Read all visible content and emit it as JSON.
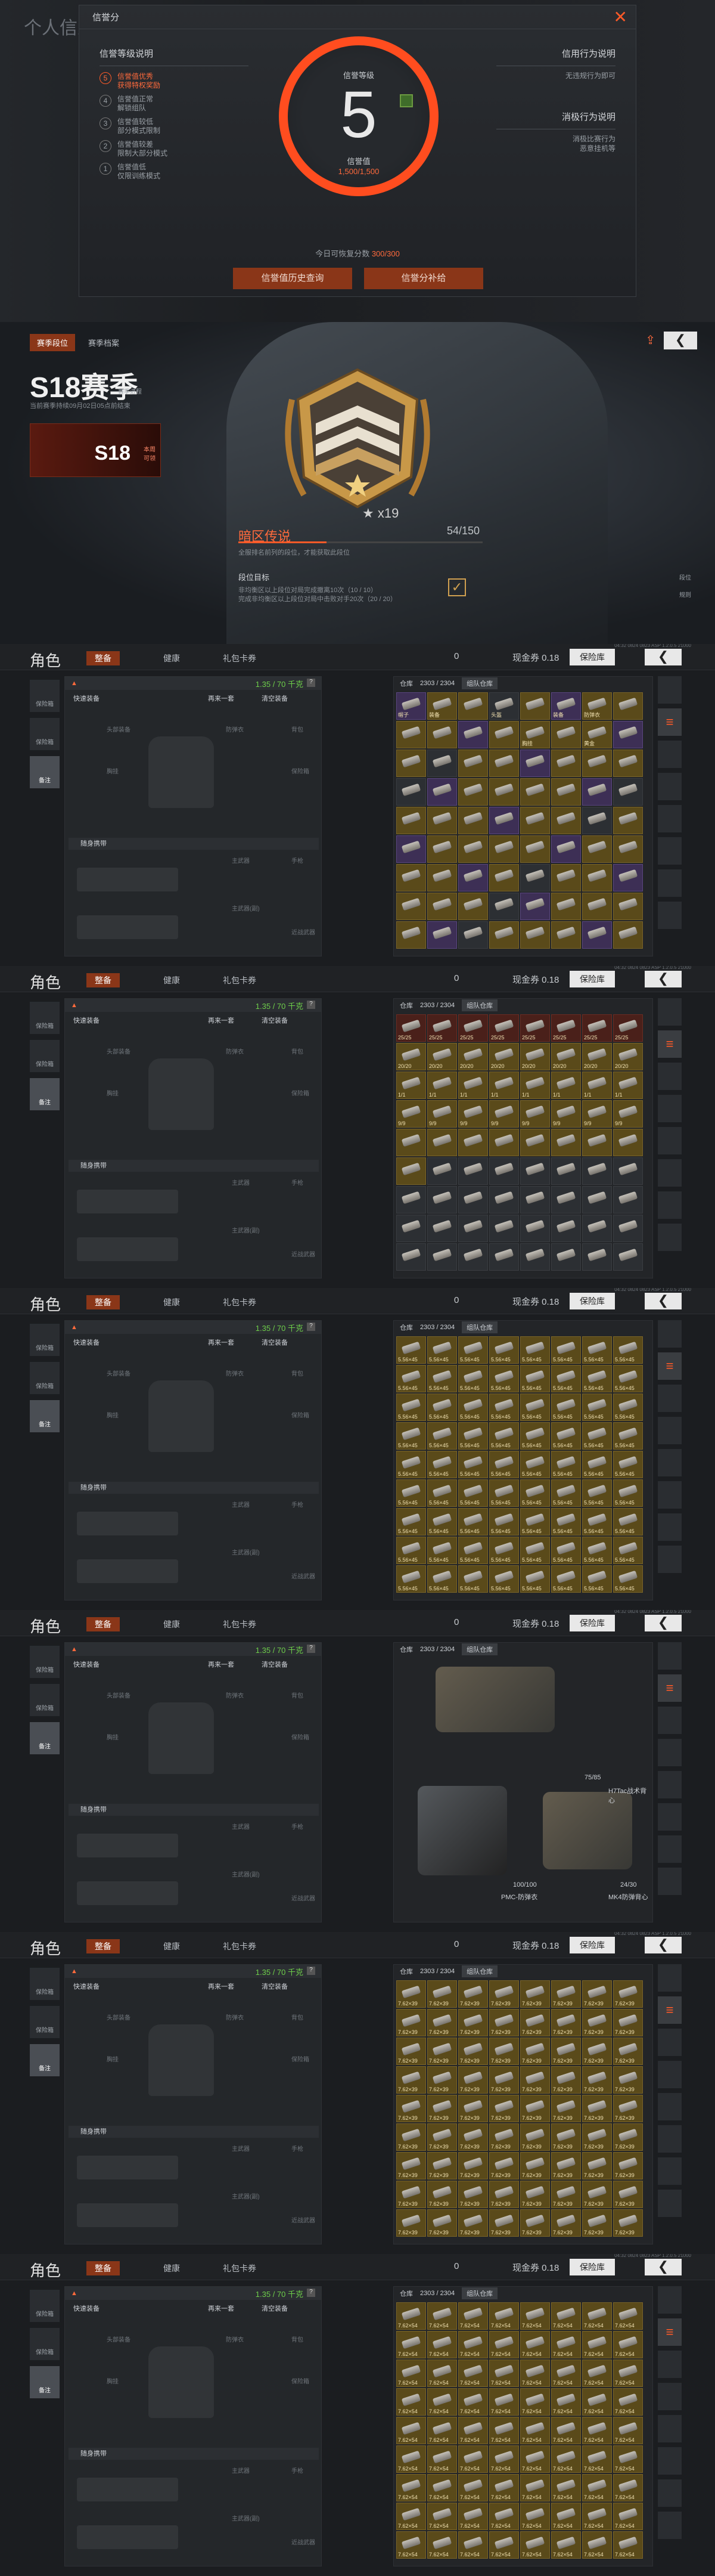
{
  "credit": {
    "bg_title": "个人信息",
    "title": "信誉分",
    "close": "✕",
    "left_heading": "信誉等级说明",
    "levels": [
      {
        "n": "5",
        "text": "信誉值优秀\n获得特权奖励"
      },
      {
        "n": "4",
        "text": "信誉值正常\n解锁组队"
      },
      {
        "n": "3",
        "text": "信誉值较低\n部分模式限制"
      },
      {
        "n": "2",
        "text": "信誉值较差\n限制大部分模式"
      },
      {
        "n": "1",
        "text": "信誉值低\n仅限训练模式"
      }
    ],
    "gauge_top": "信誉等级",
    "level": "5",
    "gauge_bottom": "信誉值",
    "progress": "1,500/1,500",
    "right_heading1": "信用行为说明",
    "right_text1": "无违规行为即可",
    "right_heading2": "消极行为说明",
    "right_text2": "消极比赛行为\n恶意挂机等",
    "daily_prefix": "今日可恢复分数 ",
    "daily_value": "300/300",
    "btn_history": "信誉值历史查询",
    "btn_compensate": "信誉分补给"
  },
  "season": {
    "tab_rank": "赛季段位",
    "tab_record": "赛季档案",
    "title": "S18赛季",
    "mini": "赛季进程",
    "subtitle": "当前赛季持续09月02日05点前结束",
    "card": "S18",
    "card_tag": "本周\n可领",
    "stars": "★ x19",
    "rank_name": "暗区传说",
    "rank_desc": "全服排名前列的段位，才能获取此段位",
    "points": "54/150",
    "goal_heading": "段位目标",
    "goal_1": "非均衡区以上段位对局完成撤离10次（10 / 10）",
    "goal_2": "完成非均衡区以上段位对局中击败对手20次（20 / 20）",
    "check": "✓",
    "back": "❮",
    "side_1": "段位",
    "side_2": "规则"
  },
  "inventory": {
    "role": "角色",
    "tab_gear": "整备",
    "tab_health": "健康",
    "tab_card": "礼包卡券",
    "balance": "0",
    "cash": "现金券 0.18",
    "store": "保险库",
    "back": "❮",
    "weight": "1.35 / 70 千克",
    "q": "?",
    "quick": "快速装备",
    "same": "再来一套",
    "clear": "清空装备",
    "helmet": "头部装备",
    "armor": "胸挂",
    "bag": "背包",
    "vest": "防弹衣",
    "backpack_sub": "保险箱",
    "carried": "随身携带",
    "main": "主武器",
    "pistol": "手枪",
    "main2": "主武器(副)",
    "knife": "近战武器",
    "left1": "保险箱",
    "left2": "保险箱",
    "left3": "备注",
    "stash_tab": "仓库",
    "stash_cap": "2303 / 2304",
    "stash_tm": "组队仓库",
    "sys": "04:32 0824 0823 ASP 1.2.0.5 21000",
    "screens": [
      {
        "kind": "mixed",
        "labels": [
          "帽子",
          "装备",
          "",
          "头盔",
          "",
          "装备",
          "防弹衣",
          "",
          "",
          "",
          "",
          "",
          "胸挂",
          "",
          "黄金",
          "",
          "",
          "",
          "",
          "",
          "",
          "",
          "",
          "",
          "",
          "",
          "",
          "",
          "",
          "",
          "",
          "",
          "",
          "",
          "",
          "",
          "",
          "",
          "",
          ""
        ]
      },
      {
        "kind": "meds",
        "labels": [
          "25/25",
          "25/25",
          "25/25",
          "25/25",
          "25/25",
          "25/25",
          "25/25",
          "25/25",
          "20/20",
          "20/20",
          "20/20",
          "20/20",
          "20/20",
          "20/20",
          "20/20",
          "20/20",
          "1/1",
          "1/1",
          "1/1",
          "1/1",
          "1/1",
          "1/1",
          "1/1",
          "1/1",
          "9/9",
          "9/9",
          "9/9",
          "9/9",
          "9/9",
          "9/9",
          "9/9",
          "9/9"
        ]
      },
      {
        "kind": "ammo",
        "label": "5.56×45"
      },
      {
        "kind": "armor",
        "a1": "75/85",
        "a2": "100/100",
        "a3": "24/30",
        "n1": "H7Tac战术背心",
        "n2": "PMC-防弹衣",
        "n3": "MK4防弹背心"
      },
      {
        "kind": "ammo",
        "label": "7.62×39"
      },
      {
        "kind": "ammo",
        "label": "7.62×54"
      }
    ]
  }
}
